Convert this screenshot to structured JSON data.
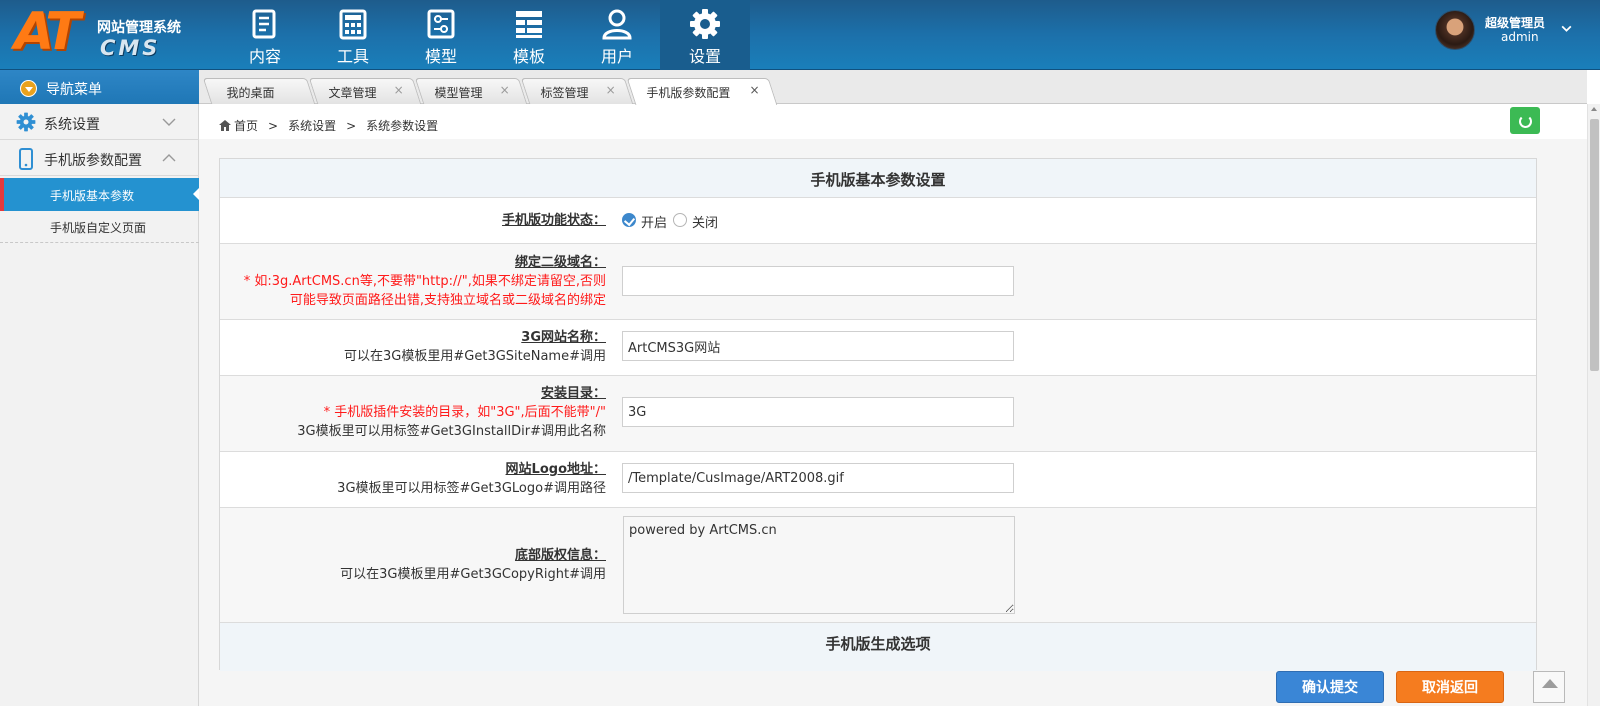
{
  "app": {
    "logo_text": "AT",
    "logo_sub": "CMS",
    "system_name": "网站管理系统"
  },
  "topnav": [
    {
      "label": "内容",
      "icon": "document-icon"
    },
    {
      "label": "工具",
      "icon": "calculator-icon"
    },
    {
      "label": "模型",
      "icon": "sliders-icon"
    },
    {
      "label": "模板",
      "icon": "layers-icon"
    },
    {
      "label": "用户",
      "icon": "user-icon"
    },
    {
      "label": "设置",
      "icon": "gear-icon",
      "active": true
    }
  ],
  "user": {
    "role": "超级管理员",
    "name": "admin"
  },
  "sidebar": {
    "header": "导航菜单",
    "sections": [
      {
        "label": "系统设置",
        "icon": "gear-icon",
        "expanded": false
      },
      {
        "label": "手机版参数配置",
        "icon": "mobile-icon",
        "expanded": true
      }
    ],
    "items": [
      {
        "label": "手机版基本参数",
        "active": true
      },
      {
        "label": "手机版自定义页面",
        "active": false
      }
    ]
  },
  "tabs": [
    {
      "label": "我的桌面",
      "closable": false
    },
    {
      "label": "文章管理",
      "closable": true
    },
    {
      "label": "模型管理",
      "closable": true
    },
    {
      "label": "标签管理",
      "closable": true
    },
    {
      "label": "手机版参数配置",
      "closable": true,
      "active": true
    }
  ],
  "tab_close_glyph": "×",
  "breadcrumb": [
    "首页",
    ">",
    "系统设置",
    ">",
    "系统参数设置"
  ],
  "form": {
    "title": "手机版基本参数设置",
    "status": {
      "label": "手机版功能状态：",
      "options": [
        "开启",
        "关闭"
      ],
      "selected": "开启"
    },
    "domain": {
      "label": "绑定二级域名：",
      "note1": "* 如:3g.ArtCMS.cn等,不要带\"http://\",如果不绑定请留空,否则",
      "note2": "可能导致页面路径出错,支持独立域名或二级域名的绑定",
      "value": ""
    },
    "site_name": {
      "label": "3G网站名称：",
      "note": "可以在3G模板里用#Get3GSiteName#调用",
      "value": "ArtCMS3G网站"
    },
    "install_dir": {
      "label": "安装目录：",
      "note1": "* 手机版插件安装的目录，如\"3G\",后面不能带\"/\"",
      "note2": "3G模板里可以用标签#Get3GInstallDir#调用此名称",
      "value": "3G"
    },
    "logo": {
      "label": "网站Logo地址：",
      "note": "3G模板里可以用标签#Get3GLogo#调用路径",
      "value": "/Template/CusImage/ART2008.gif"
    },
    "copyright": {
      "label": "底部版权信息：",
      "note": "可以在3G模板里用#Get3GCopyRight#调用",
      "value": "powered by ArtCMS.cn"
    },
    "section2_title": "手机版生成选项"
  },
  "buttons": {
    "submit": "确认提交",
    "cancel": "取消返回"
  },
  "colors": {
    "topbar": "#1c70aa",
    "accent": "#2492d0",
    "submit": "#3a86d6",
    "cancel": "#f57c1f",
    "refresh": "#3cba54"
  }
}
